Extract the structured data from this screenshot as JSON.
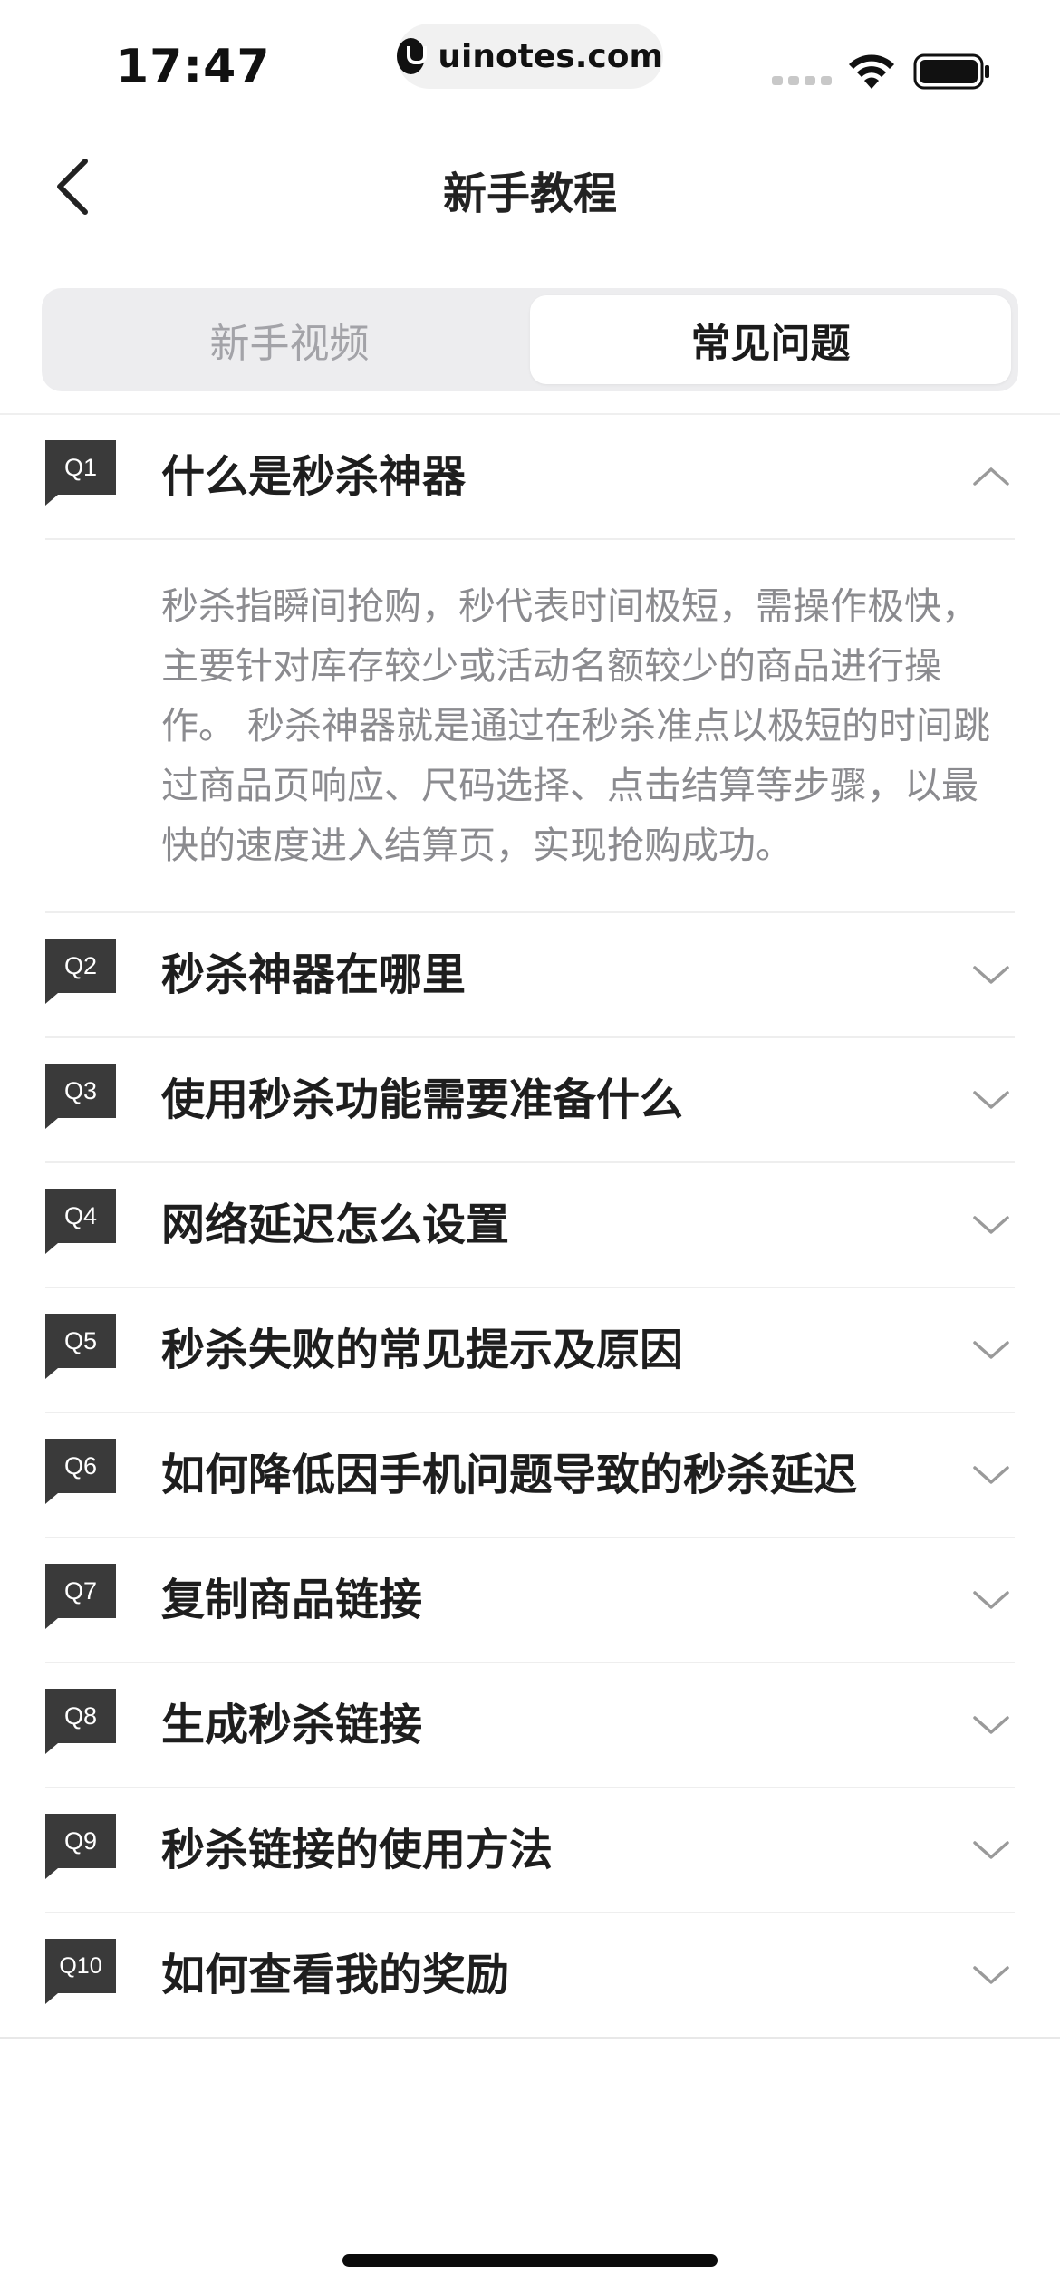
{
  "status_bar": {
    "time": "17:47",
    "url": "uinotes.com"
  },
  "nav": {
    "title": "新手教程",
    "back_icon": "chevron-left-icon"
  },
  "tabs": [
    {
      "label": "新手视频",
      "active": false
    },
    {
      "label": "常见问题",
      "active": true
    }
  ],
  "faq": [
    {
      "badge": "Q1",
      "question": "什么是秒杀神器",
      "expanded": true,
      "answer": "秒杀指瞬间抢购，秒代表时间极短，需操作极快，主要针对库存较少或活动名额较少的商品进行操作。 秒杀神器就是通过在秒杀准点以极短的时间跳过商品页响应、尺码选择、点击结算等步骤，以最快的速度进入结算页，实现抢购成功。"
    },
    {
      "badge": "Q2",
      "question": "秒杀神器在哪里",
      "expanded": false
    },
    {
      "badge": "Q3",
      "question": "使用秒杀功能需要准备什么",
      "expanded": false
    },
    {
      "badge": "Q4",
      "question": "网络延迟怎么设置",
      "expanded": false
    },
    {
      "badge": "Q5",
      "question": "秒杀失败的常见提示及原因",
      "expanded": false
    },
    {
      "badge": "Q6",
      "question": "如何降低因手机问题导致的秒杀延迟",
      "expanded": false
    },
    {
      "badge": "Q7",
      "question": "复制商品链接",
      "expanded": false
    },
    {
      "badge": "Q8",
      "question": "生成秒杀链接",
      "expanded": false
    },
    {
      "badge": "Q9",
      "question": "秒杀链接的使用方法",
      "expanded": false
    },
    {
      "badge": "Q10",
      "question": "如何查看我的奖励",
      "expanded": false
    }
  ],
  "colors": {
    "badge": "#3a3a3a",
    "answer_text": "#8b8b8f",
    "segment_bg": "#ededef"
  }
}
